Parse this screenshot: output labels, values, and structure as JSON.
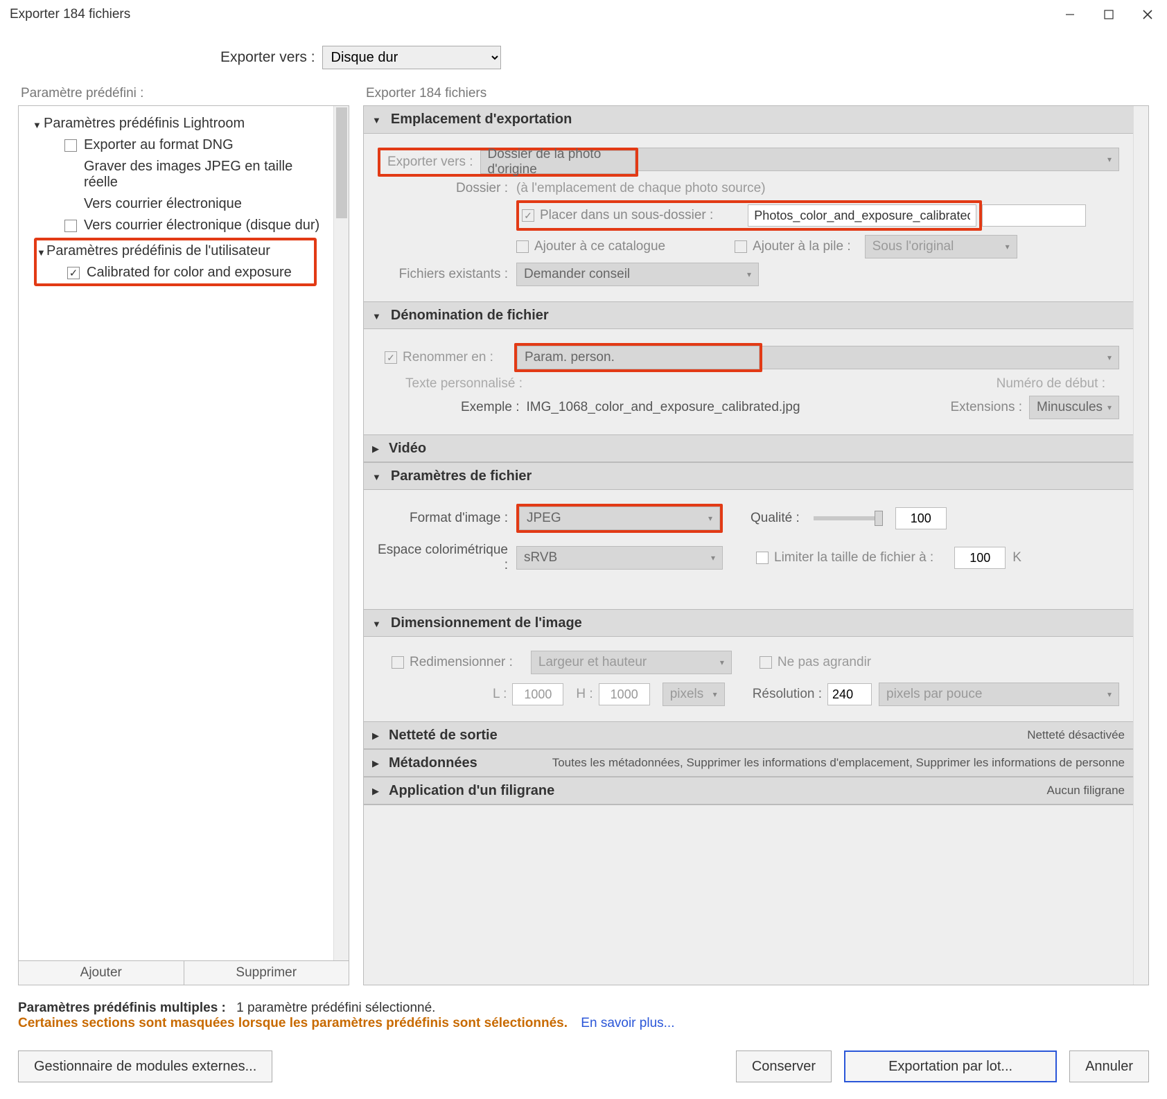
{
  "window": {
    "title": "Exporter 184 fichiers"
  },
  "top": {
    "export_to_label": "Exporter vers :",
    "export_to_value": "Disque dur"
  },
  "left": {
    "header": "Paramètre prédéfini :",
    "group_lr": "Paramètres prédéfinis Lightroom",
    "items_lr": [
      {
        "label": "Exporter au format DNG",
        "chk": "empty"
      },
      {
        "label": "Graver des images JPEG en taille réelle",
        "chk": "none"
      },
      {
        "label": "Vers courrier électronique",
        "chk": "none"
      },
      {
        "label": "Vers courrier électronique (disque dur)",
        "chk": "empty"
      }
    ],
    "group_user": "Paramètres prédéfinis de l'utilisateur",
    "items_user": [
      {
        "label": "Calibrated for color and exposure",
        "chk": "checked"
      }
    ],
    "add_btn": "Ajouter",
    "remove_btn": "Supprimer"
  },
  "right": {
    "header": "Exporter 184 fichiers",
    "sections": {
      "location": {
        "title": "Emplacement d'exportation",
        "export_to_label": "Exporter vers :",
        "export_to_value": "Dossier de la photo d'origine",
        "folder_label": "Dossier :",
        "folder_value": "(à l'emplacement de chaque photo source)",
        "subfolder_label": "Placer dans un sous-dossier :",
        "subfolder_value": "Photos_color_and_exposure_calibrated",
        "add_catalog": "Ajouter à ce catalogue",
        "add_stack": "Ajouter à la pile :",
        "stack_value": "Sous l'original",
        "existing_label": "Fichiers existants :",
        "existing_value": "Demander conseil"
      },
      "naming": {
        "title": "Dénomination de fichier",
        "rename_label": "Renommer en :",
        "rename_value": "Param. person.",
        "custom_text_label": "Texte personnalisé :",
        "start_number_label": "Numéro de début :",
        "example_label": "Exemple :",
        "example_value": "IMG_1068_color_and_exposure_calibrated.jpg",
        "extensions_label": "Extensions :",
        "extensions_value": "Minuscules"
      },
      "video": {
        "title": "Vidéo"
      },
      "file": {
        "title": "Paramètres de fichier",
        "format_label": "Format d'image :",
        "format_value": "JPEG",
        "quality_label": "Qualité :",
        "quality_value": "100",
        "colorspace_label": "Espace colorimétrique :",
        "colorspace_value": "sRVB",
        "limit_label": "Limiter la taille de fichier à :",
        "limit_value": "100",
        "limit_unit": "K"
      },
      "sizing": {
        "title": "Dimensionnement de l'image",
        "resize_label": "Redimensionner :",
        "resize_value": "Largeur et hauteur",
        "no_enlarge": "Ne pas agrandir",
        "w_label": "L :",
        "w_value": "1000",
        "h_label": "H :",
        "h_value": "1000",
        "unit_value": "pixels",
        "resolution_label": "Résolution :",
        "resolution_value": "240",
        "resolution_unit": "pixels par pouce"
      },
      "sharpen": {
        "title": "Netteté de sortie",
        "summary": "Netteté désactivée"
      },
      "metadata": {
        "title": "Métadonnées",
        "summary": "Toutes les métadonnées, Supprimer les informations d'emplacement, Supprimer les informations de personne"
      },
      "watermark": {
        "title": "Application d'un filigrane",
        "summary": "Aucun filigrane"
      }
    }
  },
  "footer": {
    "multi_label": "Paramètres prédéfinis multiples :",
    "multi_value": "1 paramètre prédéfini sélectionné.",
    "hidden_note": "Certaines sections sont masquées lorsque les paramètres prédéfinis sont sélectionnés.",
    "learn_more": "En savoir plus...",
    "plugin_btn": "Gestionnaire de modules externes...",
    "keep_btn": "Conserver",
    "export_btn": "Exportation par lot...",
    "cancel_btn": "Annuler"
  }
}
